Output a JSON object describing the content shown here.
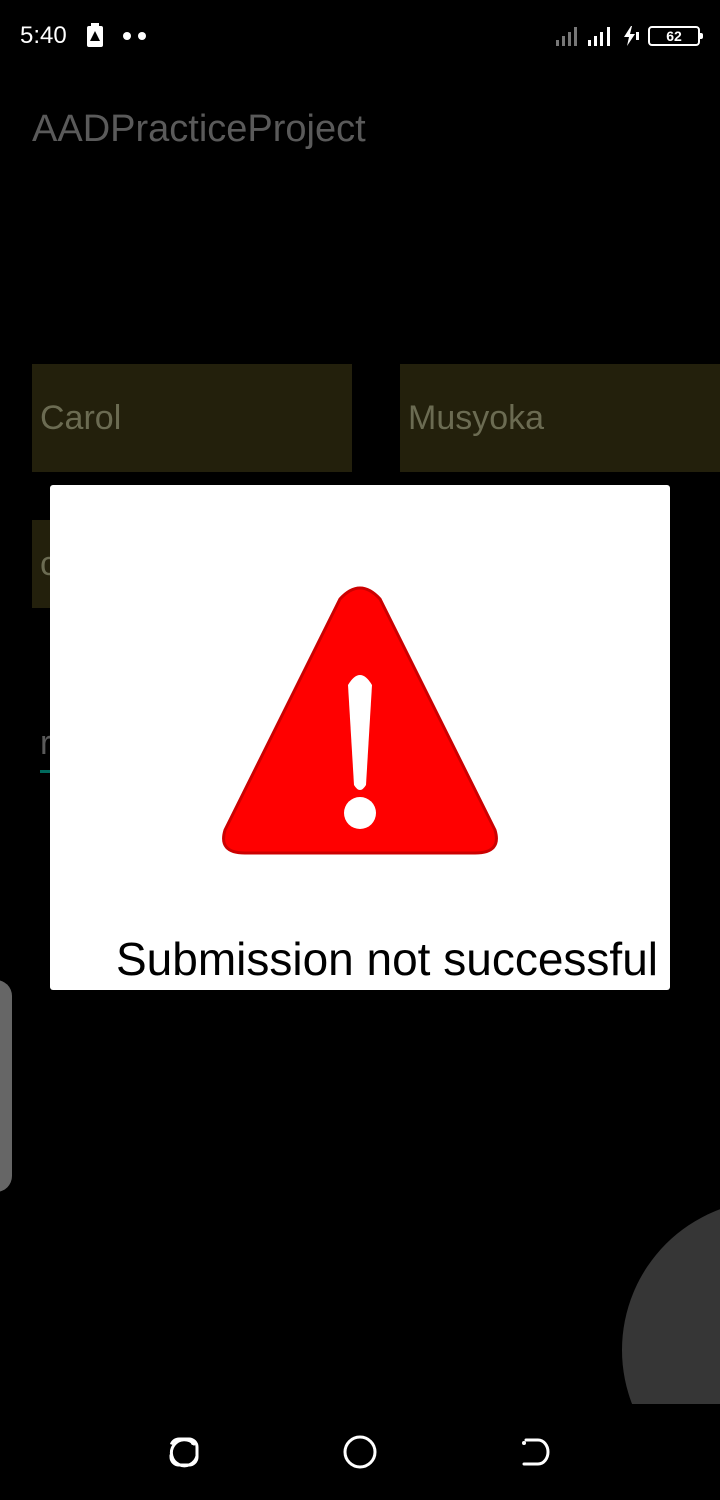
{
  "status_bar": {
    "time": "5:40",
    "battery_level": "62",
    "icons": [
      "battery-saver-icon",
      "notification-dots-icon",
      "signal-icon",
      "signal-icon",
      "charging-icon"
    ]
  },
  "app": {
    "title": "AADPracticeProject"
  },
  "form": {
    "first_name": "Carol",
    "last_name": "Musyoka",
    "email_partial": "c",
    "link_partial": "r"
  },
  "dialog": {
    "icon": "warning-icon",
    "message": "Submission not successful",
    "icon_color": "#ff0000"
  },
  "nav_bar": {
    "icons": [
      "recent-apps-icon",
      "home-icon",
      "back-icon"
    ]
  }
}
